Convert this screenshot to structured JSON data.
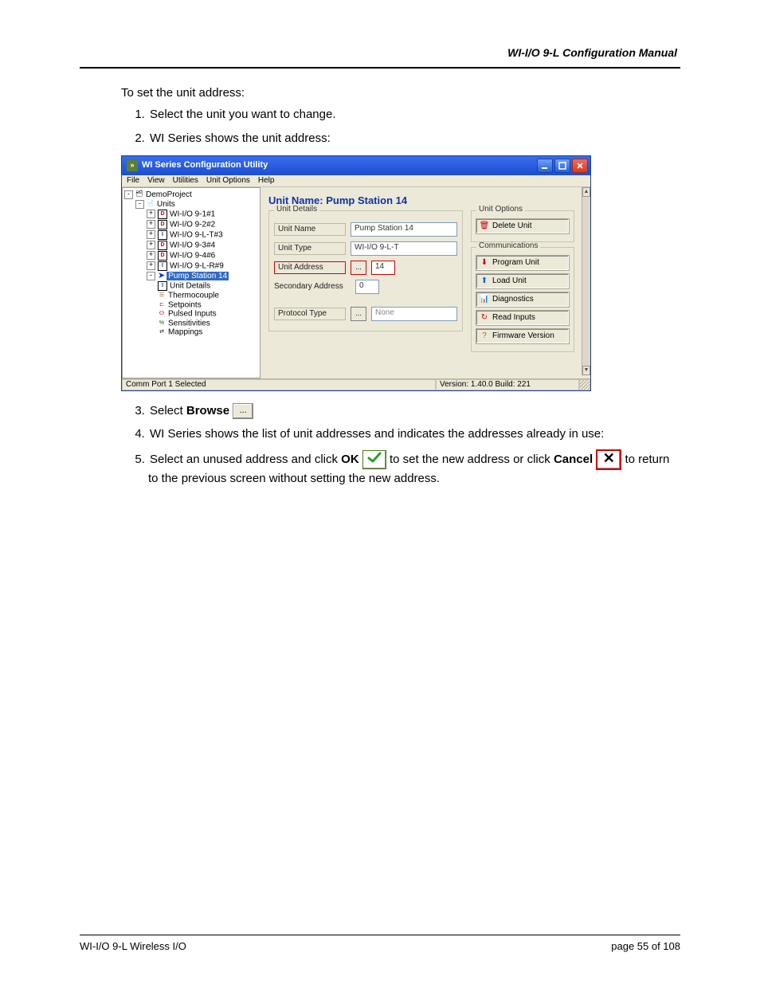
{
  "header": {
    "title": "WI-I/O 9-L Configuration Manual"
  },
  "intro": "To set the unit address:",
  "steps": {
    "s1": "Select the unit you want to change.",
    "s2": "WI Series shows the unit address:",
    "s3_pre": "Select ",
    "s3_bold": "Browse",
    "s4": "WI Series shows the list of unit addresses and indicates the addresses already in use:",
    "s5_a": "Select an unused address and click ",
    "s5_ok": "OK",
    "s5_b": " to set the new address or click ",
    "s5_cancel": "Cancel",
    "s5_c": " to return to the previous screen without setting the new address."
  },
  "app": {
    "title": "WI Series Configuration Utility",
    "menu": [
      "File",
      "View",
      "Utilities",
      "Unit Options",
      "Help"
    ],
    "tree": {
      "root": "DemoProject",
      "units_label": "Units",
      "nodes": [
        "WI-I/O 9-1#1",
        "WI-I/O 9-2#2",
        "WI-I/O 9-L-T#3",
        "WI-I/O 9-3#4",
        "WI-I/O 9-4#6",
        "WI-I/O 9-L-R#9"
      ],
      "selected": "Pump Station 14",
      "children": [
        "Unit Details",
        "Thermocouple",
        "Setpoints",
        "Pulsed Inputs",
        "Sensitivities",
        "Mappings"
      ]
    },
    "main": {
      "title": "Unit Name: Pump Station 14",
      "details_legend": "Unit Details",
      "unit_name_label": "Unit Name",
      "unit_name_value": "Pump Station 14",
      "unit_type_label": "Unit Type",
      "unit_type_value": "WI-I/O 9-L-T",
      "unit_address_label": "Unit Address",
      "unit_address_value": "14",
      "secondary_label": "Secondary Address",
      "secondary_value": "0",
      "protocol_label": "Protocol Type",
      "protocol_value": "None",
      "browse_glyph": "..."
    },
    "options": {
      "unit_legend": "Unit Options",
      "delete": "Delete Unit",
      "comm_legend": "Communications",
      "program": "Program Unit",
      "load": "Load Unit",
      "diag": "Diagnostics",
      "read": "Read Inputs",
      "fw": "Firmware Version"
    },
    "status": {
      "left": "Comm Port 1 Selected",
      "right": "Version: 1.40.0 Build: 221"
    }
  },
  "footer": {
    "left": "WI-I/O 9-L Wireless I/O",
    "right": "page  55 of 108"
  }
}
